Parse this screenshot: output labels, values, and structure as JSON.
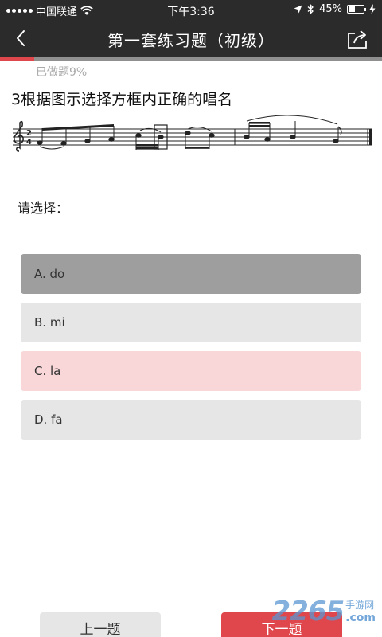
{
  "status_bar": {
    "carrier": "中国联通",
    "time": "下午3:36",
    "battery": "45%",
    "battery_level": 0.45
  },
  "nav": {
    "title": "第一套练习题（初级）"
  },
  "progress": {
    "text": "已做题9%",
    "fraction": 0.09
  },
  "question": {
    "text": "3根据图示选择方框内正确的唱名",
    "time_signature_top": "2",
    "time_signature_bottom": "4"
  },
  "select_label": "请选择：",
  "options": [
    {
      "label": "A. do",
      "state": "selected"
    },
    {
      "label": "B. mi",
      "state": "normal"
    },
    {
      "label": "C. la",
      "state": "wrong"
    },
    {
      "label": "D. fa",
      "state": "normal"
    }
  ],
  "buttons": {
    "prev": "上一题",
    "next": "下一题"
  },
  "watermark": {
    "number": "2265",
    "cn": "手游网",
    "en": ".com"
  },
  "colors": {
    "accent": "#e0474c",
    "header": "#2b2b2b",
    "selected": "#9e9e9e",
    "wrong": "#f9d7d8",
    "normal": "#e6e6e6"
  }
}
